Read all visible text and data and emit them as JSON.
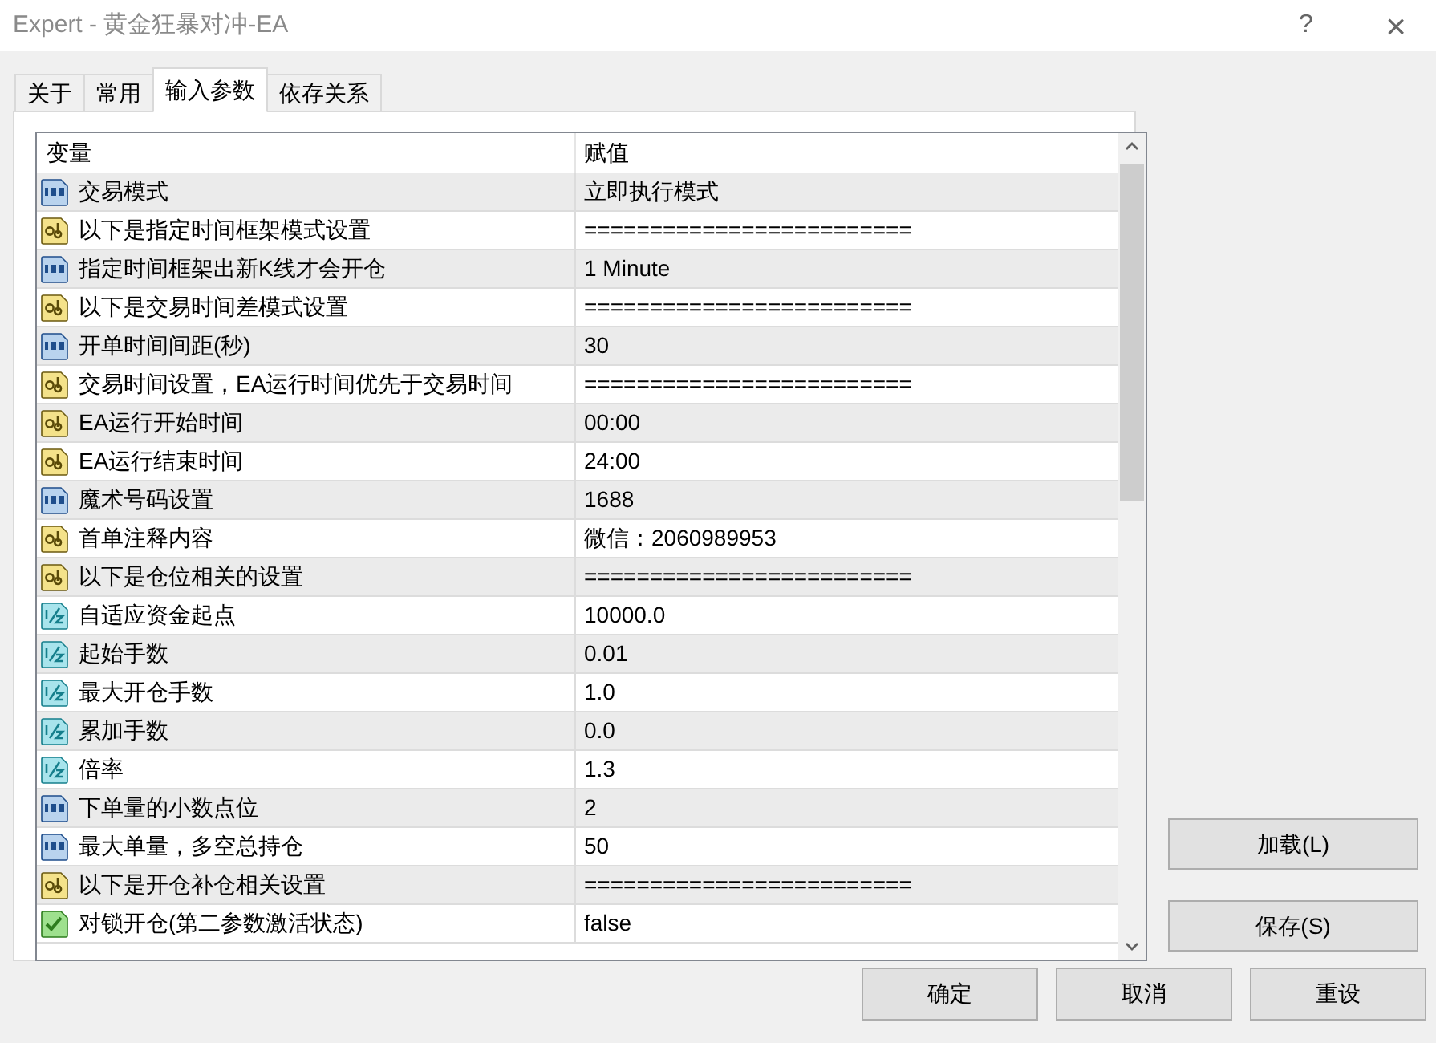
{
  "window": {
    "title": "Expert - 黄金狂暴对冲-EA",
    "help": "?",
    "close": "×"
  },
  "tabs": [
    {
      "label": "关于",
      "selected": false
    },
    {
      "label": "常用",
      "selected": false
    },
    {
      "label": "输入参数",
      "selected": true
    },
    {
      "label": "依存关系",
      "selected": false
    }
  ],
  "table": {
    "columns": [
      "变量",
      "赋值"
    ],
    "rows": [
      {
        "kind": "int",
        "name": "交易模式",
        "value": "立即执行模式"
      },
      {
        "kind": "string",
        "name": "以下是指定时间框架模式设置",
        "value": "========================="
      },
      {
        "kind": "int",
        "name": "指定时间框架出新K线才会开仓",
        "value": "1 Minute"
      },
      {
        "kind": "string",
        "name": "以下是交易时间差模式设置",
        "value": "========================="
      },
      {
        "kind": "int",
        "name": "开单时间间距(秒)",
        "value": "30"
      },
      {
        "kind": "string",
        "name": "交易时间设置，EA运行时间优先于交易时间",
        "value": "========================="
      },
      {
        "kind": "string",
        "name": "EA运行开始时间",
        "value": "00:00"
      },
      {
        "kind": "string",
        "name": "EA运行结束时间",
        "value": "24:00"
      },
      {
        "kind": "int",
        "name": "魔术号码设置",
        "value": "1688"
      },
      {
        "kind": "string",
        "name": "首单注释内容",
        "value": "微信：2060989953"
      },
      {
        "kind": "string",
        "name": "以下是仓位相关的设置",
        "value": "========================="
      },
      {
        "kind": "double",
        "name": "自适应资金起点",
        "value": "10000.0"
      },
      {
        "kind": "double",
        "name": "起始手数",
        "value": "0.01"
      },
      {
        "kind": "double",
        "name": "最大开仓手数",
        "value": "1.0"
      },
      {
        "kind": "double",
        "name": "累加手数",
        "value": "0.0"
      },
      {
        "kind": "double",
        "name": "倍率",
        "value": "1.3"
      },
      {
        "kind": "int",
        "name": "下单量的小数点位",
        "value": "2"
      },
      {
        "kind": "int",
        "name": "最大单量，多空总持仓",
        "value": "50"
      },
      {
        "kind": "string",
        "name": "以下是开仓补仓相关设置",
        "value": "========================="
      },
      {
        "kind": "bool",
        "name": "对锁开仓(第二参数激活状态)",
        "value": "false"
      }
    ]
  },
  "side_buttons": [
    "加载(L)",
    "保存(S)"
  ],
  "buttons": [
    "确定",
    "取消",
    "重设"
  ]
}
